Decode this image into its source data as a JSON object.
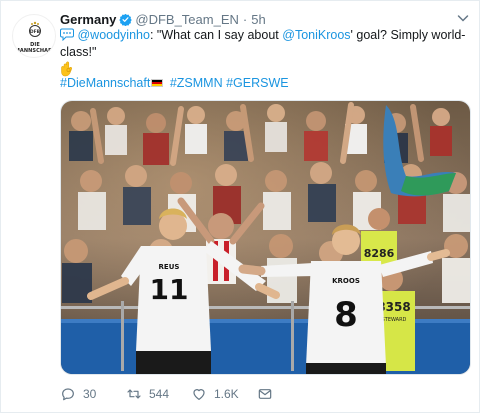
{
  "author": {
    "name": "Germany",
    "handle": "@DFB_Team_EN",
    "separator": "·",
    "time": "5h",
    "avatar_text": "DIE MANNSCHAFT",
    "verified": true
  },
  "tweet": {
    "mention": "@woodyinho",
    "text_a": ": \"What can I say about ",
    "mention2": "@ToniKroos",
    "text_b": "' goal? Simply world-class!\""
  },
  "hashtags": {
    "tag1": "#DieMannschaft",
    "tag2": "#ZSMMN",
    "tag3": "#GERSWE"
  },
  "photo": {
    "jersey_left_name": "REUS",
    "jersey_left_number": "11",
    "jersey_right_name": "KROOS",
    "jersey_right_number": "8",
    "steward_number_1": "8286",
    "steward_number_2": "8358",
    "steward_label": "STEWARD"
  },
  "actions": {
    "replies": "30",
    "retweets": "544",
    "likes": "1.6K"
  },
  "colors": {
    "link": "#1b95e0",
    "verified": "#1da1f2",
    "muted": "#657786"
  },
  "icons": {
    "speech": "speech-bubble-emoji",
    "hand": "ok-hand-emoji",
    "flag": "germany-flag-emoji",
    "reply": "reply-icon",
    "retweet": "retweet-icon",
    "like": "heart-icon",
    "dm": "envelope-icon",
    "caret": "chevron-down-icon"
  }
}
